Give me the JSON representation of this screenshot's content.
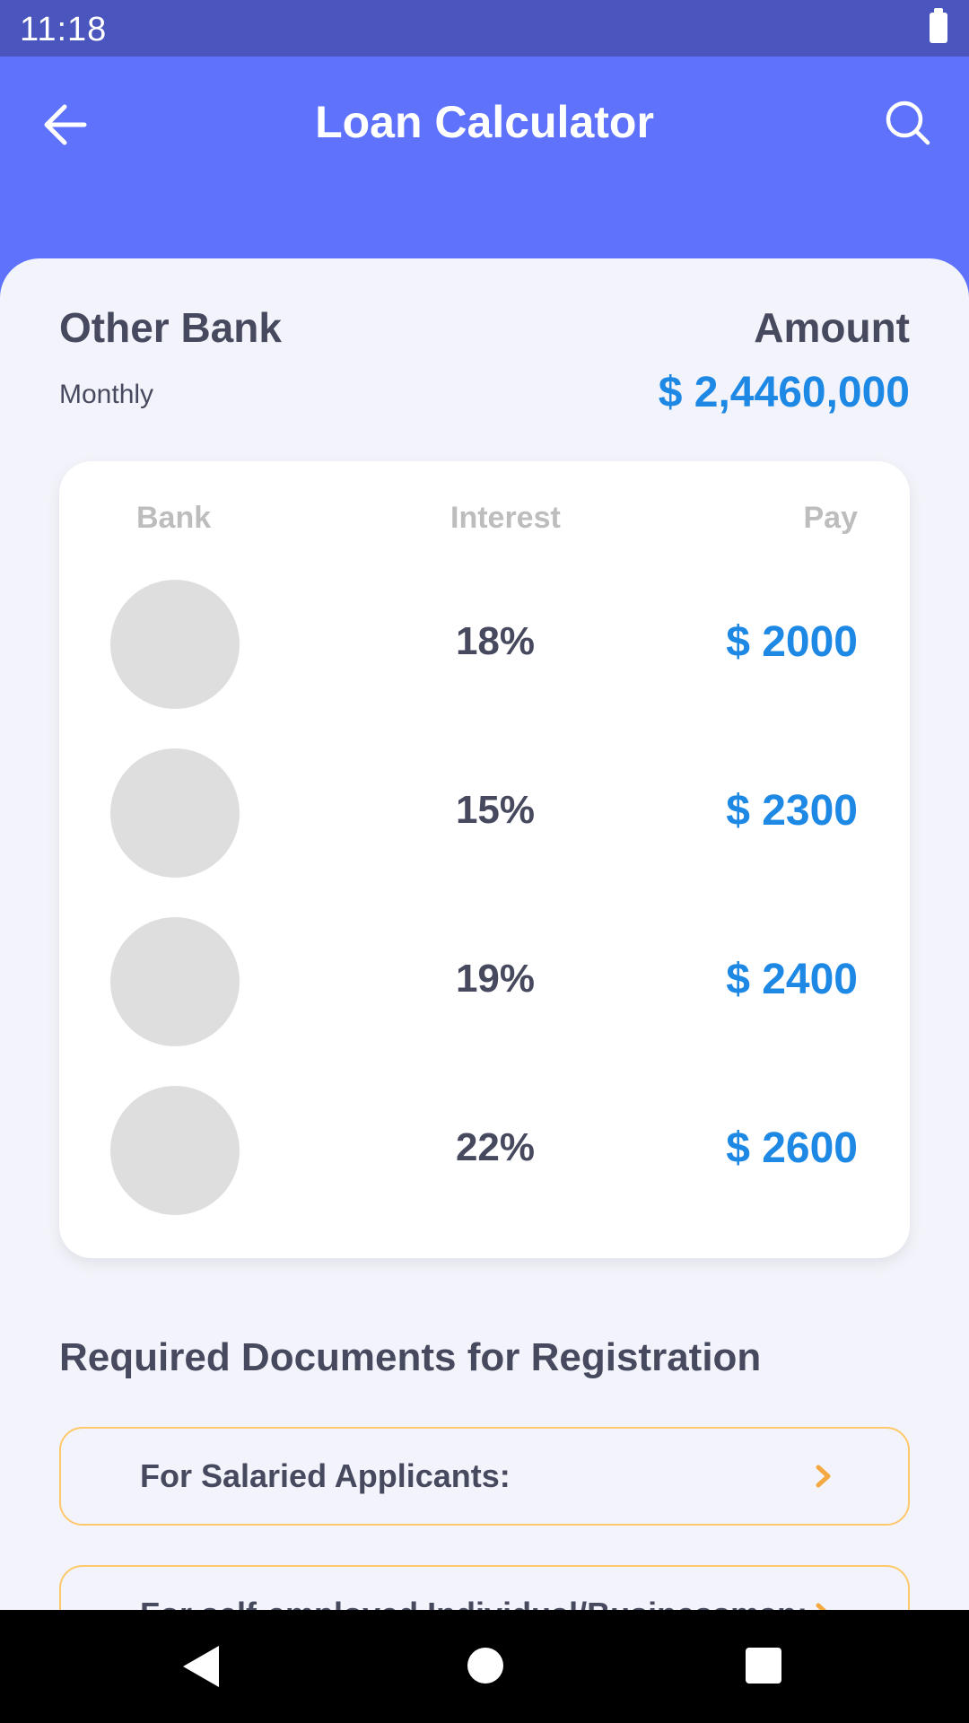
{
  "status_bar": {
    "time": "11:18"
  },
  "app_bar": {
    "title": "Loan Calculator",
    "back_icon": "arrow-left-icon",
    "search_icon": "search-icon"
  },
  "summary": {
    "bank_name": "Other Bank",
    "period": "Monthly",
    "amount_label": "Amount",
    "amount_value": "$ 2,4460,000"
  },
  "table": {
    "headers": {
      "bank": "Bank",
      "interest": "Interest",
      "pay": "Pay"
    },
    "rows": [
      {
        "interest": "18%",
        "pay": "$ 2000"
      },
      {
        "interest": "15%",
        "pay": "$ 2300"
      },
      {
        "interest": "19%",
        "pay": "$ 2400"
      },
      {
        "interest": "22%",
        "pay": "$ 2600"
      }
    ]
  },
  "documents": {
    "title": "Required Documents for Registration",
    "items": [
      {
        "label": "For Salaried Applicants:"
      },
      {
        "label": "For self-employed Individual/Businessman:"
      }
    ]
  },
  "colors": {
    "status_bar": "#4A56BE",
    "app_bar": "#5E72FB",
    "accent_blue": "#1E88E5",
    "text_dark": "#474A5F",
    "doc_border": "#FFC86B",
    "chevron": "#F4A940"
  }
}
